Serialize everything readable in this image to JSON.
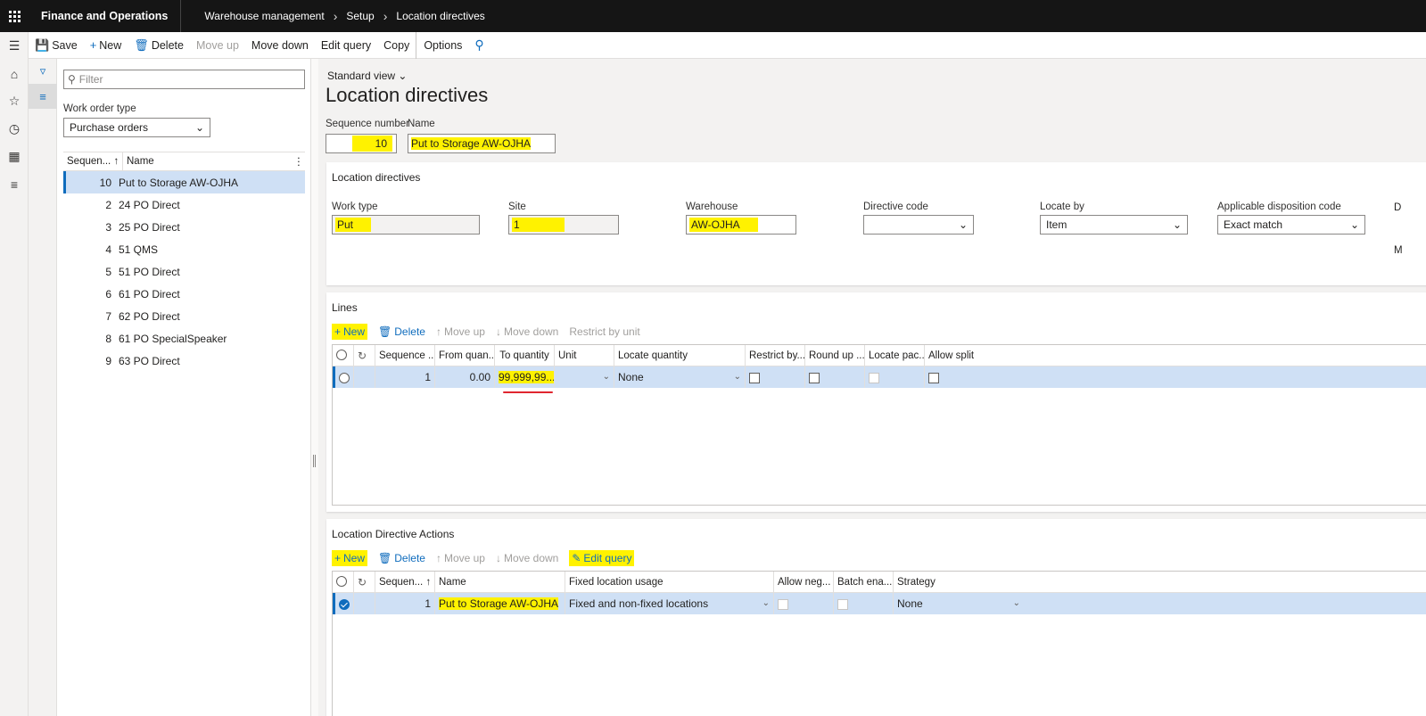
{
  "topbar": {
    "app_title": "Finance and Operations",
    "breadcrumb": [
      "Warehouse management",
      "Setup",
      "Location directives"
    ]
  },
  "actions": {
    "save": "Save",
    "new": "New",
    "delete": "Delete",
    "move_up": "Move up",
    "move_down": "Move down",
    "edit_query": "Edit query",
    "copy": "Copy",
    "options": "Options"
  },
  "list": {
    "filter_placeholder": "Filter",
    "work_order_type_label": "Work order type",
    "work_order_type_value": "Purchase orders",
    "col_sequence": "Sequen...",
    "col_name": "Name",
    "rows": [
      {
        "seq": "10",
        "name": "Put to Storage  AW-OJHA",
        "selected": true
      },
      {
        "seq": "2",
        "name": "24 PO Direct"
      },
      {
        "seq": "3",
        "name": "25 PO Direct"
      },
      {
        "seq": "4",
        "name": "51 QMS"
      },
      {
        "seq": "5",
        "name": "51 PO Direct"
      },
      {
        "seq": "6",
        "name": "61 PO Direct"
      },
      {
        "seq": "7",
        "name": "62 PO Direct"
      },
      {
        "seq": "8",
        "name": "61 PO SpecialSpeaker"
      },
      {
        "seq": "9",
        "name": "63 PO Direct"
      }
    ]
  },
  "main": {
    "standard_view": "Standard view",
    "page_title": "Location directives",
    "sequence_label": "Sequence number",
    "sequence_value": "10",
    "name_label": "Name",
    "name_value": "Put to Storage  AW-OJHA"
  },
  "directives": {
    "title": "Location directives",
    "work_type_label": "Work type",
    "work_type_value": "Put",
    "site_label": "Site",
    "site_value": "1",
    "warehouse_label": "Warehouse",
    "warehouse_value": "AW-OJHA",
    "directive_code_label": "Directive code",
    "directive_code_value": "",
    "locate_by_label": "Locate by",
    "locate_by_value": "Item",
    "disposition_label": "Applicable disposition code",
    "disposition_value": "Exact match",
    "edge_label_1": "D",
    "edge_label_2": "M"
  },
  "lines": {
    "title": "Lines",
    "toolbar": {
      "new": "New",
      "delete": "Delete",
      "move_up": "Move up",
      "move_down": "Move down",
      "restrict": "Restrict by unit"
    },
    "columns": [
      "Sequence ...",
      "From quan...",
      "To quantity",
      "Unit",
      "Locate quantity",
      "Restrict by...",
      "Round up ...",
      "Locate pac...",
      "Allow split"
    ],
    "row": {
      "seq": "1",
      "from": "0.00",
      "to": "99,999,99...",
      "unit": "",
      "locate_qty": "None"
    }
  },
  "actions_grid": {
    "title": "Location Directive Actions",
    "toolbar": {
      "new": "New",
      "delete": "Delete",
      "move_up": "Move up",
      "move_down": "Move down",
      "edit_query": "Edit query"
    },
    "columns": [
      "Sequen...",
      "Name",
      "Fixed location usage",
      "Allow neg...",
      "Batch ena...",
      "Strategy"
    ],
    "row": {
      "seq": "1",
      "name": "Put to Storage  AW-OJHA",
      "fixed_usage": "Fixed and non-fixed locations",
      "strategy": "None"
    }
  },
  "colors": {
    "accent": "#0f6cbd",
    "highlight": "#fff200",
    "topbar": "#151515",
    "underline": "#e0262f"
  }
}
